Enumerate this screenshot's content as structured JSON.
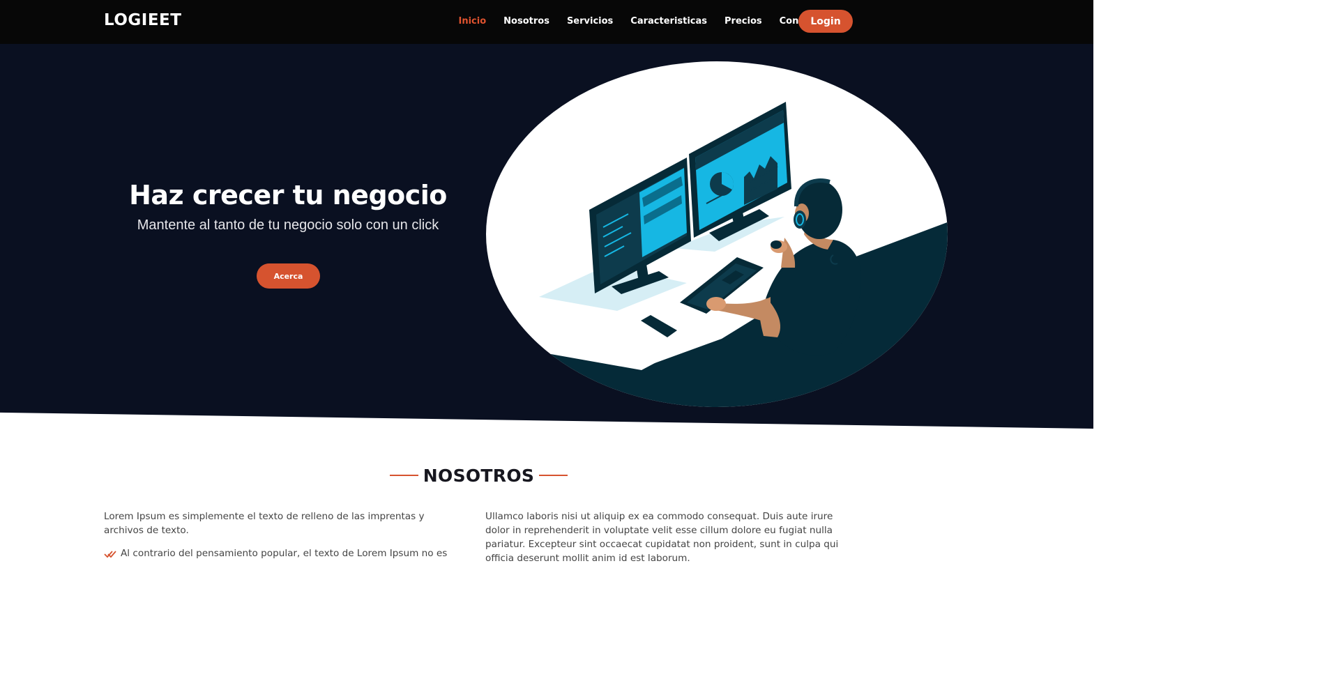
{
  "brand": {
    "logo": "LOGIEET"
  },
  "nav": {
    "items": [
      {
        "label": "Inicio",
        "active": true
      },
      {
        "label": "Nosotros",
        "active": false
      },
      {
        "label": "Servicios",
        "active": false
      },
      {
        "label": "Caracteristicas",
        "active": false
      },
      {
        "label": "Precios",
        "active": false
      },
      {
        "label": "Contacto",
        "active": false
      }
    ],
    "login_label": "Login"
  },
  "hero": {
    "title": "Haz crecer tu negocio",
    "subtitle": "Mantente al tanto de tu negocio solo con un click",
    "button_label": "Acerca",
    "illustration_icon": "person-at-computer-illustration"
  },
  "about": {
    "title": "NOSOTROS",
    "left_paragraph": "Lorem Ipsum es simplemente el texto de relleno de las imprentas y archivos de texto.",
    "list_item_1": "Al contrario del pensamiento popular, el texto de Lorem Ipsum no es",
    "list_icon": "double-check-icon",
    "right_paragraph": "Ullamco laboris nisi ut aliquip ex ea commodo consequat. Duis aute irure dolor in reprehenderit in voluptate velit esse cillum dolore eu fugiat nulla pariatur. Excepteur sint occaecat cupidatat non proident, sunt in culpa qui officia deserunt mollit anim id est laborum."
  },
  "colors": {
    "accent": "#d6532f",
    "header_bg": "#070707",
    "hero_bg": "#0a1021",
    "illustration_dark": "#052a38",
    "illustration_screen": "#16b7e3"
  }
}
